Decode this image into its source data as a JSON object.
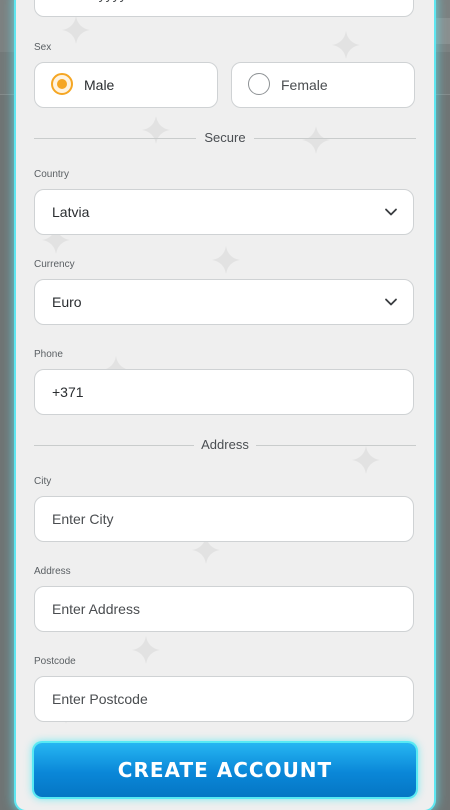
{
  "dob": {
    "placeholder": "dd/mm/yyyy"
  },
  "sex": {
    "label": "Sex",
    "options": [
      {
        "label": "Male",
        "selected": true
      },
      {
        "label": "Female",
        "selected": false
      }
    ]
  },
  "sections": {
    "secure": "Secure",
    "address": "Address"
  },
  "country": {
    "label": "Country",
    "value": "Latvia"
  },
  "currency": {
    "label": "Currency",
    "value": "Euro"
  },
  "phone": {
    "label": "Phone",
    "value": "+371"
  },
  "city": {
    "label": "City",
    "placeholder": "Enter City"
  },
  "address": {
    "label": "Address",
    "placeholder": "Enter Address"
  },
  "postcode": {
    "label": "Postcode",
    "placeholder": "Enter Postcode"
  },
  "submit": {
    "label": "CREATE ACCOUNT"
  },
  "colors": {
    "accent_glow": "#5fe6f0",
    "radio_selected": "#f5a623",
    "button_blue": "#0a87d8",
    "panel_bg": "#efefef"
  },
  "icons": {
    "select_arrow": "chevron-down-icon"
  }
}
